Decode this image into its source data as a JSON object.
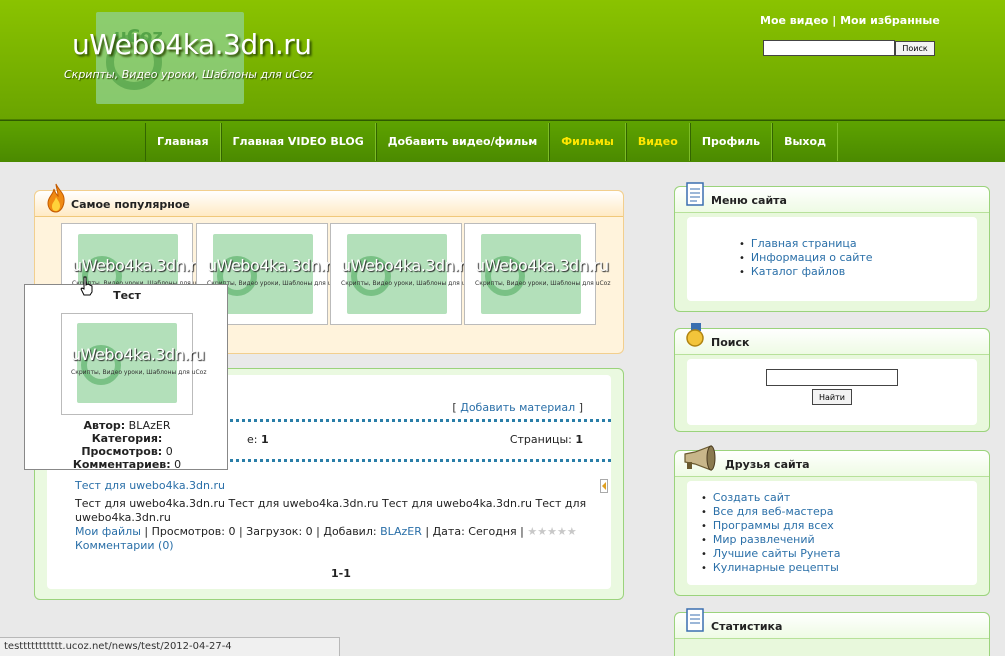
{
  "header": {
    "site_title": "uWebo4ka.3dn.ru",
    "slogan": "Скрипты, Видео уроки, Шаблоны для uCoz",
    "logo_text": "uCoz",
    "top_link_1": "Мое видео",
    "top_link_sep": "|",
    "top_link_2": "Мои избранные",
    "search_button": "Поиск"
  },
  "nav": {
    "items": [
      {
        "label": "Главная",
        "highlight": false
      },
      {
        "label": "Главная VIDEO BLOG",
        "highlight": false
      },
      {
        "label": "Добавить видео/фильм",
        "highlight": false
      },
      {
        "label": "Фильмы",
        "highlight": true
      },
      {
        "label": "Видео",
        "highlight": true
      },
      {
        "label": "Профиль",
        "highlight": false
      },
      {
        "label": "Выход",
        "highlight": false
      }
    ],
    "highlight_color": "#ffe600"
  },
  "popular": {
    "title": "Самое популярное",
    "thumb_name": "uWebo4ka.3dn.ru",
    "thumb_sub": "Скрипты, Видео уроки, Шаблоны для uCoz"
  },
  "tooltip": {
    "title": "Тест",
    "author_label": "Автор:",
    "author_value": "BLAzER",
    "category_label": "Категория:",
    "views_label": "Просмотров:",
    "views_value": "0",
    "comments_label": "Комментариев:",
    "comments_value": "0"
  },
  "main": {
    "add_material_open": "[",
    "add_material": "Добавить материал",
    "add_material_close": "]",
    "count_suffix": "е:",
    "count_value": "1",
    "pages_label": "Страницы:",
    "pages_value": "1",
    "entry_title": "Тест для uwebo4ka.3dn.ru",
    "entry_text": "Тест для uwebo4ka.3dn.ru Тест для uwebo4ka.3dn.ru Тест для uwebo4ka.3dn.ru Тест для uwebo4ka.3dn.ru",
    "meta_category": "Мои файлы",
    "meta_views": "| Просмотров: 0 | Загрузок: 0 | Добавил:",
    "meta_author": "BLAzER",
    "meta_date": "| Дата: Сегодня |",
    "comments_link": "Комментарии (0)",
    "pager": "1-1"
  },
  "sidebar": {
    "menu_title": "Меню сайта",
    "menu_items": [
      "Главная страница",
      "Информация о сайте",
      "Каталог файлов"
    ],
    "search_title": "Поиск",
    "search_button": "Найти",
    "friends_title": "Друзья сайта",
    "friends_items": [
      "Создать сайт",
      "Все для веб-мастера",
      "Программы для всех",
      "Мир развлечений",
      "Лучшие сайты Рунета",
      "Кулинарные рецепты"
    ],
    "stats_title": "Статистика"
  },
  "status_bar": "testtttttttttt.ucoz.net/news/test/2012-04-27-4",
  "colors": {
    "header_green": "#78b000",
    "link_blue": "#2a6fa8",
    "box_green": "#e8f8dc",
    "popular_orange": "#fff3dc"
  }
}
